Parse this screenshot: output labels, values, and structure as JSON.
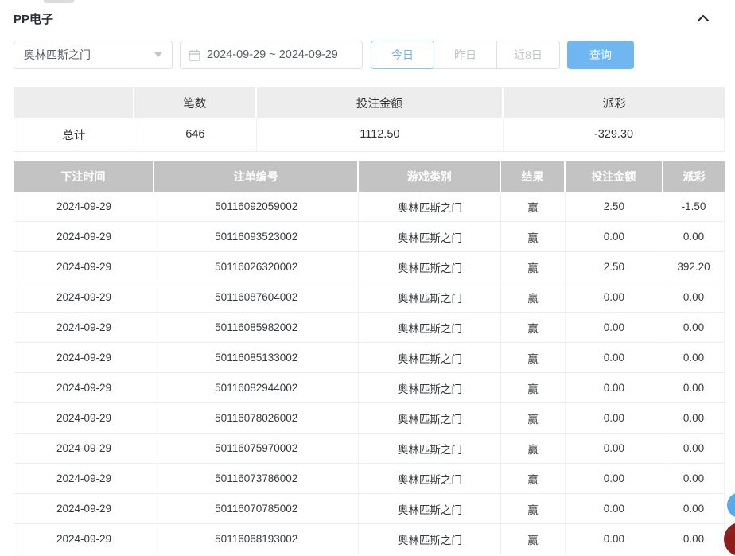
{
  "page": {
    "title": "PP电子"
  },
  "colors": {
    "accent_blue": "#70b7f1",
    "negative_red": "#f56c6c",
    "table_header_gray": "#c3c3c3"
  },
  "filters": {
    "game_select": {
      "value": "奥林匹斯之门"
    },
    "date_range": {
      "value": "2024-09-29 ~ 2024-09-29"
    },
    "quick_buttons": [
      {
        "label": "今日",
        "active": true
      },
      {
        "label": "昨日",
        "active": false
      },
      {
        "label": "近8日",
        "active": false
      }
    ],
    "query_label": "查询"
  },
  "summary": {
    "headers": [
      "",
      "笔数",
      "投注金额",
      "派彩"
    ],
    "row": {
      "label": "总计",
      "count": "646",
      "bet_amount": "1112.50",
      "payout": "-329.30"
    }
  },
  "table": {
    "headers": [
      "下注时间",
      "注单编号",
      "游戏类别",
      "结果",
      "投注金额",
      "派彩"
    ],
    "rows": [
      {
        "date": "2024-09-29",
        "order_no": "50116092059002",
        "game": "奥林匹斯之门",
        "result": "赢",
        "bet": "2.50",
        "payout": "-1.50"
      },
      {
        "date": "2024-09-29",
        "order_no": "50116093523002",
        "game": "奥林匹斯之门",
        "result": "赢",
        "bet": "0.00",
        "payout": "0.00"
      },
      {
        "date": "2024-09-29",
        "order_no": "50116026320002",
        "game": "奥林匹斯之门",
        "result": "赢",
        "bet": "2.50",
        "payout": "392.20"
      },
      {
        "date": "2024-09-29",
        "order_no": "50116087604002",
        "game": "奥林匹斯之门",
        "result": "赢",
        "bet": "0.00",
        "payout": "0.00"
      },
      {
        "date": "2024-09-29",
        "order_no": "50116085982002",
        "game": "奥林匹斯之门",
        "result": "赢",
        "bet": "0.00",
        "payout": "0.00"
      },
      {
        "date": "2024-09-29",
        "order_no": "50116085133002",
        "game": "奥林匹斯之门",
        "result": "赢",
        "bet": "0.00",
        "payout": "0.00"
      },
      {
        "date": "2024-09-29",
        "order_no": "50116082944002",
        "game": "奥林匹斯之门",
        "result": "赢",
        "bet": "0.00",
        "payout": "0.00"
      },
      {
        "date": "2024-09-29",
        "order_no": "50116078026002",
        "game": "奥林匹斯之门",
        "result": "赢",
        "bet": "0.00",
        "payout": "0.00"
      },
      {
        "date": "2024-09-29",
        "order_no": "50116075970002",
        "game": "奥林匹斯之门",
        "result": "赢",
        "bet": "0.00",
        "payout": "0.00"
      },
      {
        "date": "2024-09-29",
        "order_no": "50116073786002",
        "game": "奥林匹斯之门",
        "result": "赢",
        "bet": "0.00",
        "payout": "0.00"
      },
      {
        "date": "2024-09-29",
        "order_no": "50116070785002",
        "game": "奥林匹斯之门",
        "result": "赢",
        "bet": "0.00",
        "payout": "0.00"
      },
      {
        "date": "2024-09-29",
        "order_no": "50116068193002",
        "game": "奥林匹斯之门",
        "result": "赢",
        "bet": "0.00",
        "payout": "0.00"
      }
    ]
  }
}
